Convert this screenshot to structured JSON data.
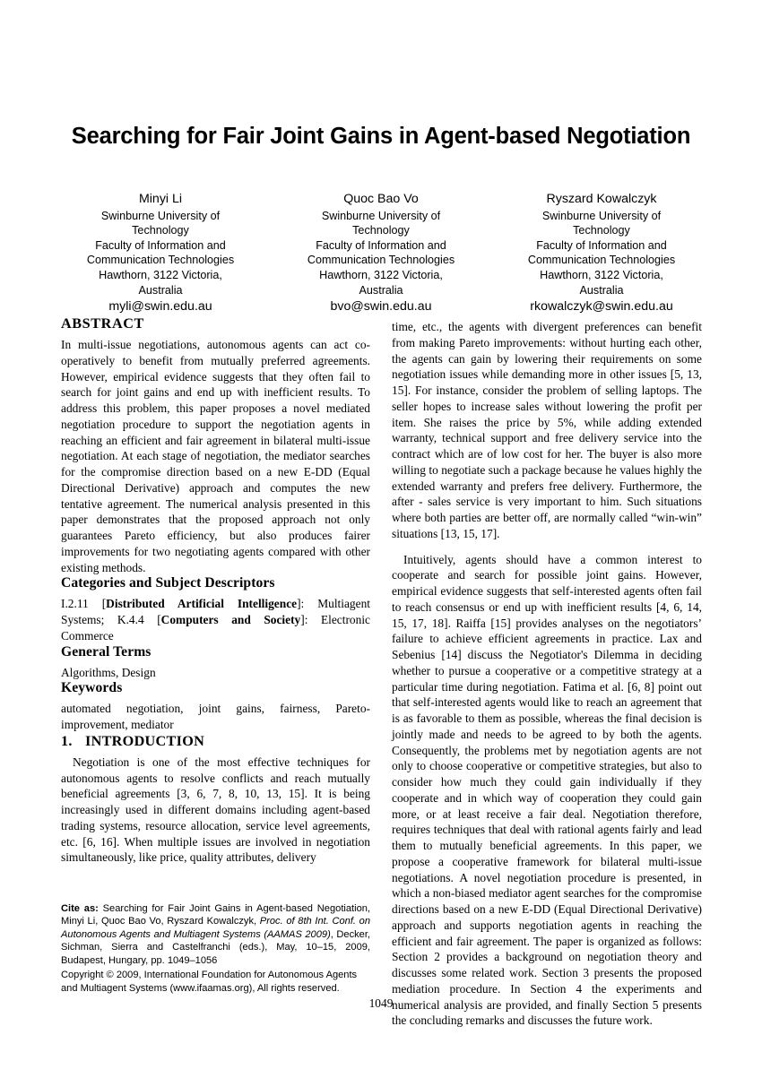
{
  "paper": {
    "title": "Searching for Fair Joint Gains in Agent-based Negotiation",
    "page_number": "1049"
  },
  "authors": [
    {
      "name": "Minyi Li",
      "affiliation_lines": [
        "Swinburne University of",
        "Technology",
        "Faculty of Information and",
        "Communication Technologies",
        "Hawthorn, 3122 Victoria,",
        "Australia"
      ],
      "email": "myli@swin.edu.au"
    },
    {
      "name": "Quoc Bao Vo",
      "affiliation_lines": [
        "Swinburne University of",
        "Technology",
        "Faculty of Information and",
        "Communication Technologies",
        "Hawthorn, 3122 Victoria,",
        "Australia"
      ],
      "email": "bvo@swin.edu.au"
    },
    {
      "name": "Ryszard Kowalczyk",
      "affiliation_lines": [
        "Swinburne University of",
        "Technology",
        "Faculty of Information and",
        "Communication Technologies",
        "Hawthorn, 3122 Victoria,",
        "Australia"
      ],
      "email": "rkowalczyk@swin.edu.au"
    }
  ],
  "sections": {
    "abstract": {
      "heading": "ABSTRACT",
      "text": "In multi-issue negotiations, autonomous agents can act co-operatively to benefit from mutually preferred agreements. However, empirical evidence suggests that they often fail to search for joint gains and end up with inefficient results. To address this problem, this paper proposes a novel mediated negotiation procedure to support the negotiation agents in reaching an efficient and fair agreement in bilateral multi-issue negotiation. At each stage of negotiation, the mediator searches for the compromise direction based on a new E-DD (Equal Directional Derivative) approach and computes the new tentative agreement. The numerical analysis presented in this paper demonstrates that the proposed approach not only guarantees Pareto efficiency, but also produces fairer improvements for two negotiating agents compared with other existing methods."
    },
    "categories": {
      "heading": "Categories and Subject Descriptors",
      "prefix1": "I.2.11 [",
      "bold1": "Distributed Artificial Intelligence",
      "mid1": "]: Multiagent Systems; K.4.4 [",
      "bold2": "Computers and Society",
      "suffix": "]: Electronic Commerce"
    },
    "general_terms": {
      "heading": "General Terms",
      "text": "Algorithms, Design"
    },
    "keywords": {
      "heading": "Keywords",
      "text": "automated negotiation, joint gains, fairness, Pareto-improvement, mediator"
    },
    "introduction": {
      "number": "1.",
      "heading": "INTRODUCTION",
      "para1": "Negotiation is one of the most effective techniques for autonomous agents to resolve conflicts and reach mutually beneficial agreements [3, 6, 7, 8, 10, 13, 15]. It is being increasingly used in different domains including agent-based trading systems, resource allocation, service level agreements, etc. [6, 16]. When multiple issues are involved in negotiation simultaneously, like price, quality attributes, delivery"
    },
    "right_column": {
      "para1": "time, etc., the agents with divergent preferences can benefit from making Pareto improvements: without hurting each other, the agents can gain by lowering their requirements on some negotiation issues while demanding more in other issues [5, 13, 15]. For instance, consider the problem of selling laptops. The seller hopes to increase sales without lowering the profit per item. She raises the price by 5%, while adding extended warranty, technical support and free delivery service into the contract which are of low cost for her. The buyer is also more willing to negotiate such a package because he values highly the extended warranty and prefers free delivery. Furthermore, the after - sales service is very important to him. Such situations where both parties are better off, are normally called “win-win” situations [13, 15, 17].",
      "para2": "Intuitively, agents should have a common interest to cooperate and search for possible joint gains. However, empirical evidence suggests that self-interested agents often fail to reach consensus or end up with inefficient results [4, 6, 14, 15, 17, 18]. Raiffa [15] provides analyses on the negotiators’ failure to achieve efficient agreements in practice. Lax and Sebenius [14] discuss the Negotiator's Dilemma in deciding whether to pursue a cooperative or a competitive strategy at a particular time during negotiation. Fatima et al. [6, 8] point out that self-interested agents would like to reach an agreement that is as favorable to them as possible, whereas the final decision is jointly made and needs to be agreed to by both the agents. Consequently, the problems met by negotiation agents are not only to choose cooperative or competitive strategies, but also to consider how much they could gain individually if they cooperate and in which way of cooperation they could gain more, or at least receive a fair deal. Negotiation therefore, requires techniques that deal with rational agents fairly and lead them to mutually beneficial agreements. In this paper, we propose a cooperative framework for bilateral multi-issue negotiations. A novel negotiation procedure is presented, in which a non-biased mediator agent searches for the compromise directions based on a new E-DD (Equal Directional Derivative) approach and supports negotiation agents in reaching the efficient and fair agreement. The paper is organized as follows: Section 2 provides a background on negotiation theory and discusses some related work. Section 3 presents the proposed mediation procedure. In Section 4 the experiments and numerical analysis are provided, and finally Section 5 presents the concluding remarks and discusses the future work."
    }
  },
  "cite_as": {
    "label": "Cite as:",
    "text_plain_1": " Searching for Fair Joint Gains in Agent-based Negotiation, Minyi Li, Quoc Bao Vo, Ryszard Kowalczyk, ",
    "italic_1": "Proc. of 8th Int. Conf. on Autonomous Agents and Multiagent Systems (AAMAS 2009)",
    "text_plain_2": ", Decker, Sichman, Sierra and Castelfranchi (eds.), May, 10–15, 2009, Budapest, Hungary, pp. 1049–1056",
    "copyright": "Copyright © 2009, International Foundation for Autonomous Agents and Multiagent Systems (www.ifaamas.org), All rights reserved."
  }
}
